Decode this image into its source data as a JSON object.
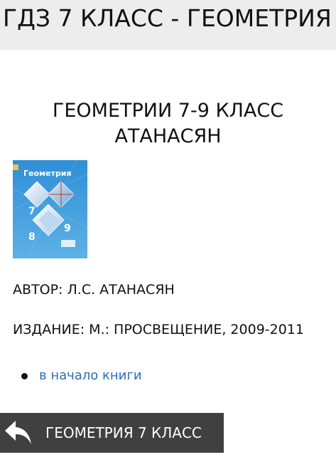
{
  "header": {
    "title": "ГДЗ 7 КЛАСС - ГЕОМЕТРИЯ"
  },
  "book": {
    "title_line1": "ГЕОМЕТРИИ 7-9 КЛАСС",
    "title_line2": "АТАНАСЯН",
    "cover": {
      "title": "Геометрия",
      "grades": [
        "7",
        "8",
        "9"
      ],
      "background_color": "#3b9ad9"
    },
    "author": "АВТОР: Л.С. АТАНАСЯН",
    "edition": "ИЗДАНИЕ: М.: ПРОСВЕЩЕНИЕ, 2009-2011"
  },
  "nav": {
    "items": [
      {
        "label": "в начало книги",
        "icon": "bullet"
      }
    ]
  },
  "footer": {
    "back_label": "ГЕОМЕТРИЯ 7 КЛАСС",
    "back_icon": "reply-arrow-icon"
  },
  "colors": {
    "header_bg": "#ededed",
    "link": "#2a6fb5",
    "back_bar_bg": "#404040"
  }
}
